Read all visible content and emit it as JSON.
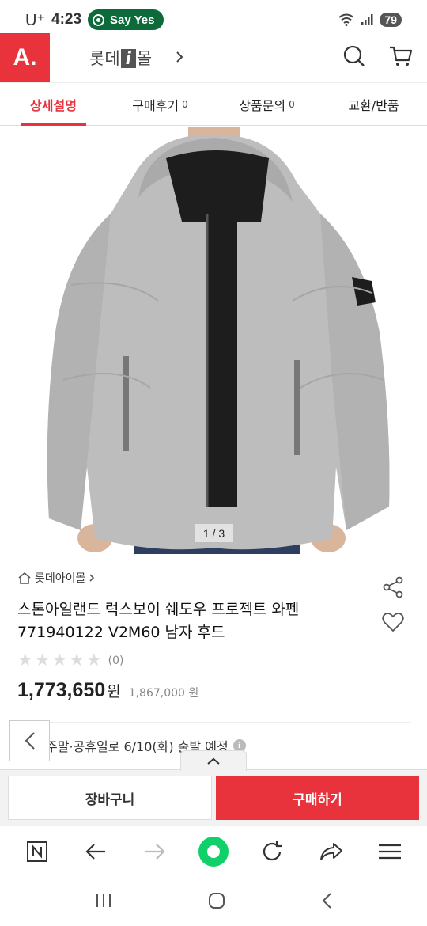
{
  "status": {
    "carrier": "U⁺",
    "time": "4:23",
    "badge": "Say Yes",
    "battery": "79"
  },
  "header": {
    "logo": "A.",
    "brand": "롯데i몰",
    "brand_pre": "롯데",
    "brand_i": "i",
    "brand_post": "몰",
    "icons": [
      "chevron-right-icon",
      "search-icon",
      "cart-icon"
    ]
  },
  "tabs": [
    {
      "label": "상세설명",
      "count": "",
      "active": true
    },
    {
      "label": "구매후기",
      "count": "0",
      "active": false
    },
    {
      "label": "상품문의",
      "count": "0",
      "active": false
    },
    {
      "label": "교환/반품",
      "count": "",
      "active": false
    }
  ],
  "gallery": {
    "pager": "1 / 3"
  },
  "product": {
    "store": "롯데아이몰",
    "title_line1": "스톤아일랜드 럭스보이 쉐도우 프로젝트 와펜",
    "title_line2": "771940122 V2M60 남자 후드",
    "rating_count": "(0)",
    "price": "1,773,650",
    "currency": "원",
    "original_price": "1,867,000 원",
    "shipping": "주말·공휴일로 6/10(화) 출발 예정"
  },
  "actions": {
    "cart": "장바구니",
    "buy": "구매하기"
  },
  "colors": {
    "accent": "#e8333d",
    "dark_green": "#0c6a3b"
  }
}
